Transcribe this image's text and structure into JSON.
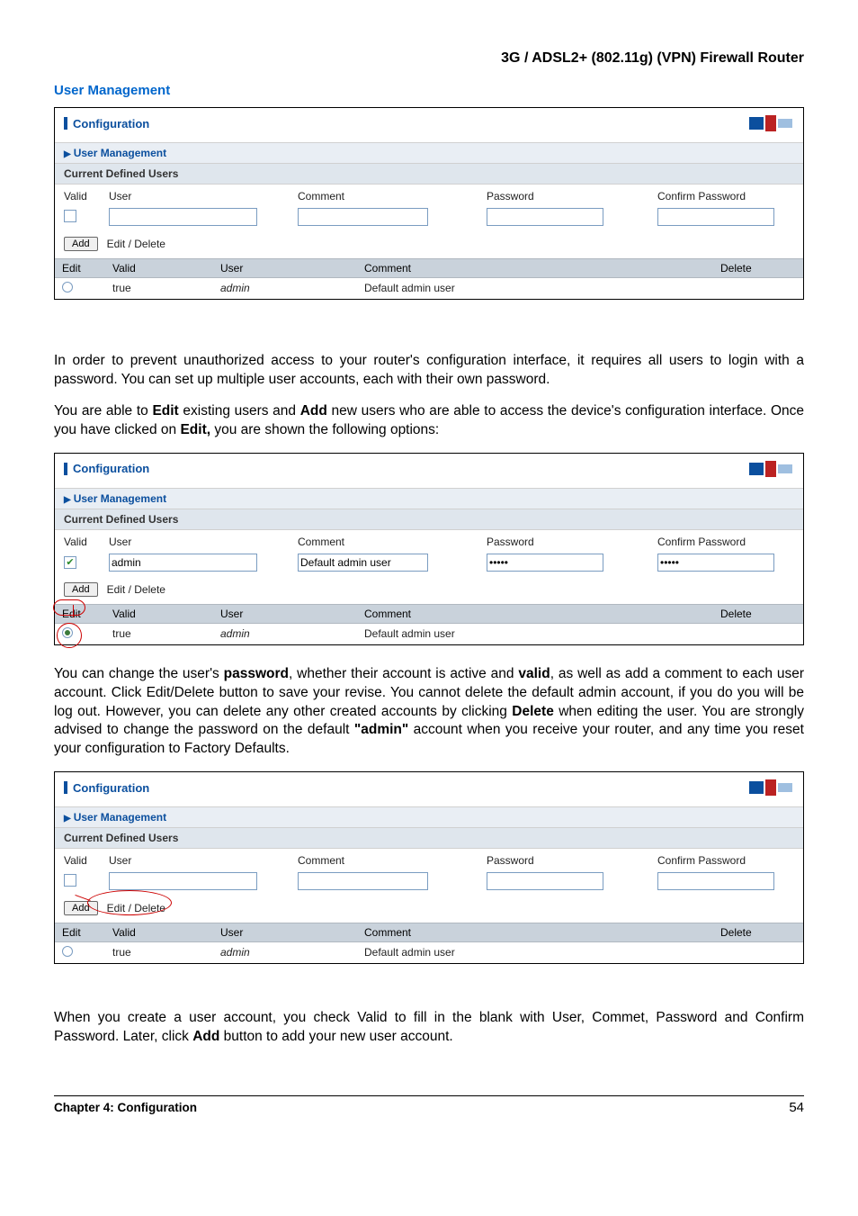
{
  "header": {
    "title": "3G / ADSL2+ (802.11g) (VPN) Firewall Router"
  },
  "section_heading": "User Management",
  "panel_common": {
    "config_title": "Configuration",
    "user_mgmt": "User Management",
    "current_defined": "Current Defined Users",
    "labels": {
      "valid": "Valid",
      "user": "User",
      "comment": "Comment",
      "password": "Password",
      "confirm": "Confirm Password"
    },
    "add_btn": "Add",
    "edit_delete": "Edit / Delete",
    "table_head": {
      "edit": "Edit",
      "valid": "Valid",
      "user": "User",
      "comment": "Comment",
      "delete": "Delete"
    },
    "row": {
      "valid": "true",
      "user": "admin",
      "comment": "Default admin user"
    }
  },
  "panel2_values": {
    "user": "admin",
    "comment": "Default admin user",
    "password": "•••••",
    "confirm": "•••••"
  },
  "para1": "In order to prevent unauthorized access to your router's configuration interface, it requires all users to login with a password. You can set up multiple user accounts, each with their own password.",
  "para2_a": "You are able to ",
  "para2_b": " existing users and ",
  "para2_c": " new users who are able to access the device's configuration interface. Once you have clicked on ",
  "para2_d": " you are shown the following options:",
  "bold": {
    "edit": "Edit",
    "add": "Add",
    "edit_comma": "Edit,",
    "password": "password",
    "valid": "valid",
    "delete": "Delete",
    "admin_q": "\"admin\"",
    "add2": "Add"
  },
  "para3_a": "You can change the user's ",
  "para3_b": ", whether their account is active and ",
  "para3_c": ", as well as add a comment to each user account.   Click Edit/Delete button to save your revise.   You cannot delete the default admin account, if you do you will be log out.   However, you can delete any other created accounts by clicking ",
  "para3_d": " when editing the user.    You are strongly advised to change the password on the default ",
  "para3_e": " account when you receive your router, and any time you reset your configuration to Factory Defaults.",
  "para4_a": "When you create a user account, you check Valid to fill in the blank with User, Commet, Password and Confirm Password.    Later, click ",
  "para4_b": " button to add your new user account.",
  "footer": {
    "chapter": "Chapter 4: Configuration",
    "page": "54"
  }
}
